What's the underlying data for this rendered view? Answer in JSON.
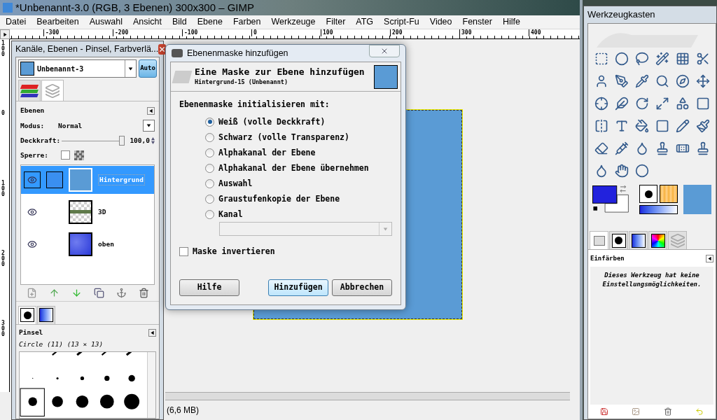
{
  "main_window": {
    "title": "*Unbenannt-3.0 (RGB, 3 Ebenen) 300x300 – GIMP",
    "menu": [
      "Datei",
      "Bearbeiten",
      "Auswahl",
      "Ansicht",
      "Bild",
      "Ebene",
      "Farben",
      "Werkzeuge",
      "Filter",
      "ATG",
      "Script-Fu",
      "Video",
      "Fenster",
      "Hilfe"
    ],
    "ruler_labels": [
      "-300",
      "-200",
      "-100",
      "0",
      "100",
      "200",
      "300",
      "400"
    ],
    "vertical_ruler_labels": [
      "100",
      "0",
      "100",
      "200",
      "300"
    ],
    "status": "(6,6 MB)"
  },
  "layers_dock": {
    "title": "Kanäle, Ebenen - Pinsel, Farbverlä...",
    "image": "Unbenannt-3",
    "auto_button": "Auto",
    "tabs": [
      {
        "kind": "channels",
        "selected": false
      },
      {
        "kind": "layers",
        "selected": true
      }
    ],
    "heading": "Ebenen",
    "mode_label": "Modus:",
    "mode": "Normal",
    "opacity_label": "Deckkraft:",
    "opacity": {
      "level": 1.0,
      "reading": "100,0"
    },
    "lock_label": "Sperre:",
    "lock_checked": false,
    "layers": [
      {
        "name": "Hintergrund",
        "visible": true,
        "selected": true,
        "kind": "plain"
      },
      {
        "name": "3D",
        "visible": true,
        "selected": false,
        "kind": "checker"
      },
      {
        "name": "oben",
        "visible": true,
        "selected": false,
        "kind": "texture"
      }
    ],
    "brush_tabs": [
      {
        "kind": "brush",
        "selected": true
      },
      {
        "kind": "gradient",
        "selected": false
      }
    ],
    "brush_heading": "Pinsel",
    "brush_name": "Circle (11) (13 × 13)"
  },
  "dialog": {
    "title": "Ebenenmaske hinzufügen",
    "header": "Eine Maske zur Ebene hinzufügen",
    "subheader": "Hintergrund-15 (Unbenannt)",
    "prompt": "Ebenenmaske initialisieren mit:",
    "options": [
      {
        "label": "Weiß (volle Deckkraft)",
        "selected": true
      },
      {
        "label": "Schwarz (volle Transparenz)",
        "selected": false
      },
      {
        "label": "Alphakanal der Ebene",
        "selected": false
      },
      {
        "label": "Alphakanal der Ebene übernehmen",
        "selected": false
      },
      {
        "label": "Auswahl",
        "selected": false
      },
      {
        "label": "Graustufenkopie der Ebene",
        "selected": false
      },
      {
        "label": "Kanal",
        "selected": false
      }
    ],
    "channel_select_disabled": true,
    "invert": {
      "label": "Maske invertieren",
      "checked": false
    },
    "buttons": [
      {
        "label": "Hilfe",
        "default": false
      },
      {
        "label": "Hinzufügen",
        "default": true
      },
      {
        "label": "Abbrechen",
        "default": false
      }
    ]
  },
  "toolbox": {
    "title": "Werkzeugkasten",
    "tabs": [
      {
        "kind": "options",
        "selected": true
      },
      {
        "kind": "brush",
        "selected": false
      },
      {
        "kind": "gradient",
        "selected": false
      },
      {
        "kind": "palette",
        "selected": false
      },
      {
        "kind": "layers",
        "selected": false
      }
    ],
    "options_heading": "Einfärben",
    "options_message": "Dieses Werkzeug hat keine Einstellungsmöglichkeiten."
  }
}
